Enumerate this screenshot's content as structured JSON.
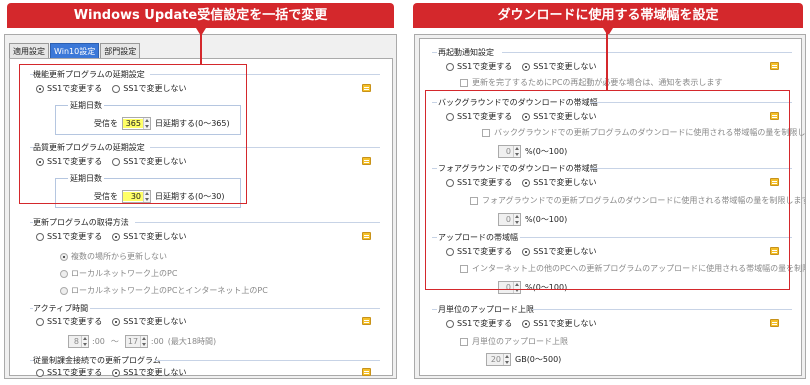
{
  "left": {
    "banner": "Windows Update受信設定を一括で変更",
    "tabs": [
      "適用設定",
      "Win10設定",
      "部門設定"
    ],
    "radio_change": "SS1で変更する",
    "radio_nochange": "SS1で変更しない",
    "feature": {
      "title": "機能更新プログラムの延期設定",
      "days_label": "延期日数",
      "receive": "受信を",
      "value": "365",
      "suffix": "日延期する(0〜365)"
    },
    "quality": {
      "title": "品質更新プログラムの延期設定",
      "days_label": "延期日数",
      "receive": "受信を",
      "value": "30",
      "suffix": "日延期する(0〜30)"
    },
    "acquire": {
      "title": "更新プログラムの取得方法",
      "opt1": "複数の場所から更新しない",
      "opt2": "ローカルネットワーク上のPC",
      "opt3": "ローカルネットワーク上のPCとインターネット上のPC"
    },
    "active": {
      "title": "アクティブ時間",
      "start": "8",
      "colon1": ":00",
      "tilde": "〜",
      "end": "17",
      "colon2": ":00",
      "note": "(最大18時間)"
    },
    "metered": {
      "title": "従量制課金接続での更新プログラム"
    }
  },
  "right": {
    "banner": "ダウンロードに使用する帯域幅を設定",
    "radio_change": "SS1で変更する",
    "radio_nochange": "SS1で変更しない",
    "restart": {
      "title": "再起動通知設定",
      "check": "更新を完了するためにPCの再起動が必要な場合は、通知を表示します"
    },
    "background": {
      "title": "バックグラウンドでのダウンロードの帯域幅",
      "check": "バックグラウンドでの更新プログラムのダウンロードに使用される帯域幅の量を制限します",
      "value": "0",
      "range": "%(0〜100)"
    },
    "foreground": {
      "title": "フォアグラウンドでのダウンロードの帯域幅",
      "check": "フォアグラウンドでの更新プログラムのダウンロードに使用される帯域幅の量を制限します",
      "value": "0",
      "range": "%(0〜100)"
    },
    "upload": {
      "title": "アップロードの帯域幅",
      "check": "インターネット上の他のPCへの更新プログラムのアップロードに使用される帯域幅の量を制限します",
      "value": "0",
      "range": "%(0〜100)"
    },
    "monthly": {
      "title": "月単位のアップロード上限",
      "check": "月単位のアップロード上限",
      "value": "20",
      "range": "GB(0〜500)"
    }
  }
}
